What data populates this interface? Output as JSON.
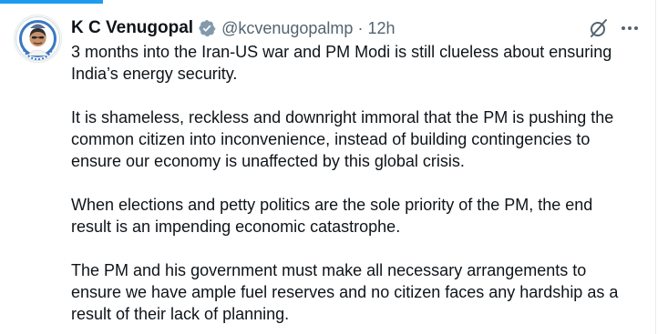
{
  "tweet": {
    "author": {
      "display_name": "K C Venugopal",
      "handle": "@kcvenugopalmp",
      "verified": true,
      "avatar_icon": "avatar-photo-icon"
    },
    "separator": "·",
    "time": "12h",
    "paragraphs": [
      "3 months into the Iran-US war and PM Modi is still clueless about ensuring\nIndia’s energy security.",
      "It is shameless, reckless and downright immoral that the PM is pushing the\ncommon citizen into inconvenience, instead of building contingencies to\nensure our economy is unaffected by this global crisis.",
      "When elections and petty politics are the sole priority of the PM, the end\nresult is an impending economic catastrophe.",
      "The PM and his government must make all necessary arrangements to\nensure we have ample fuel reserves and no citizen faces any hardship as a\nresult of their lack of planning."
    ]
  },
  "icons": {
    "verified": "verified-badge-icon",
    "grok": "grok-icon",
    "more": "more-options-icon"
  },
  "colors": {
    "accent": "#1d9bf0",
    "text": "#0f1419",
    "secondary_text": "#536471"
  }
}
